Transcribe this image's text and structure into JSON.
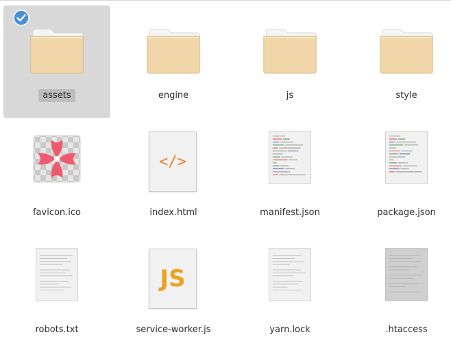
{
  "files": [
    {
      "name": "assets",
      "icon": "folder-icon",
      "selected": true
    },
    {
      "name": "engine",
      "icon": "folder-icon",
      "selected": false
    },
    {
      "name": "js",
      "icon": "folder-icon",
      "selected": false
    },
    {
      "name": "style",
      "icon": "folder-icon",
      "selected": false
    },
    {
      "name": "favicon.ico",
      "icon": "image-file-icon",
      "selected": false
    },
    {
      "name": "index.html",
      "icon": "html-file-icon",
      "selected": false
    },
    {
      "name": "manifest.json",
      "icon": "code-file-icon",
      "selected": false
    },
    {
      "name": "package.json",
      "icon": "code-file-icon",
      "selected": false
    },
    {
      "name": "robots.txt",
      "icon": "text-file-icon",
      "selected": false
    },
    {
      "name": "service-worker.js",
      "icon": "js-file-icon",
      "selected": false
    },
    {
      "name": "yarn.lock",
      "icon": "text-file-icon",
      "selected": false
    },
    {
      "name": ".htaccess",
      "icon": "hidden-file-icon",
      "selected": false
    }
  ],
  "html_icon_glyph": "</>",
  "js_icon_glyph": "JS",
  "colors": {
    "folder_body": "#f0d6a8",
    "folder_tab": "#e2c48e",
    "selection_check": "#4a90d9",
    "favicon_accent": "#f05a6e",
    "html_accent": "#f07f2c",
    "js_accent": "#e8a325"
  }
}
